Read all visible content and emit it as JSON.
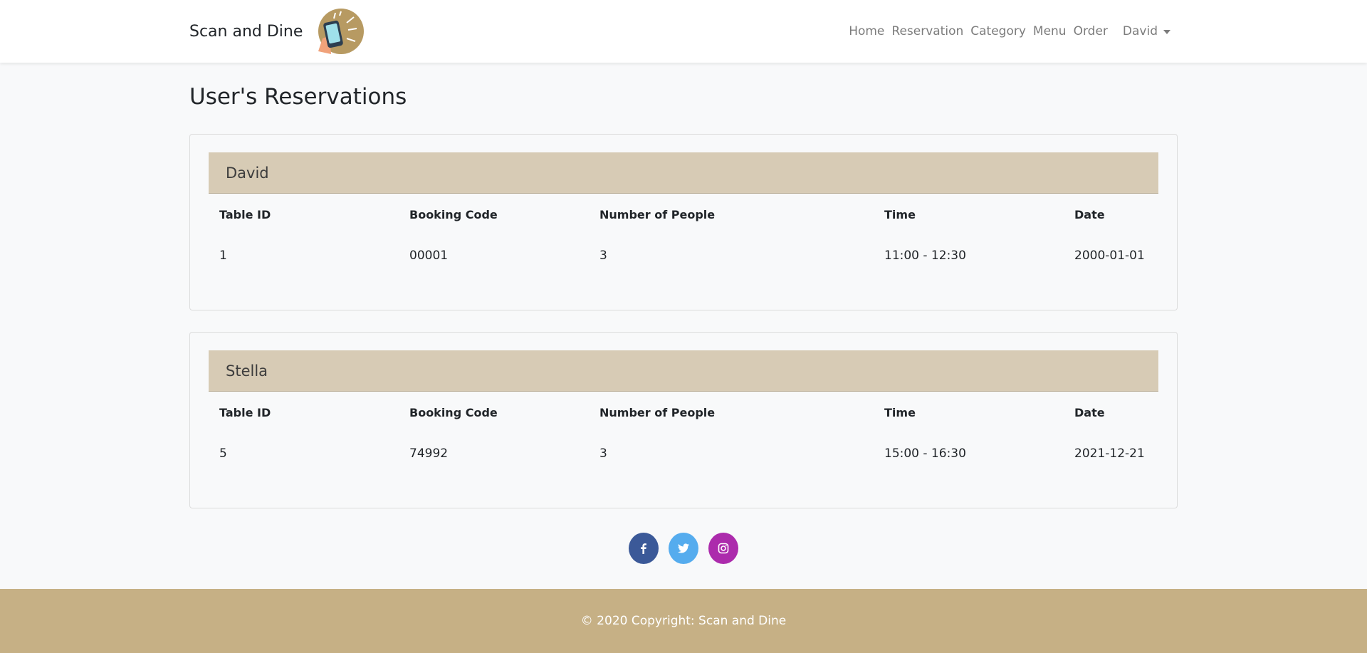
{
  "brand": {
    "name": "Scan and Dine",
    "logo_icon": "phone-hand-icon"
  },
  "nav": {
    "links": [
      "Home",
      "Reservation",
      "Category",
      "Menu",
      "Order"
    ],
    "user": "David"
  },
  "page": {
    "title": "User's Reservations"
  },
  "table_headers": [
    "Table ID",
    "Booking Code",
    "Number of People",
    "Time",
    "Date"
  ],
  "reservations": [
    {
      "name": "David",
      "rows": [
        {
          "table_id": "1",
          "booking_code": "00001",
          "people": "3",
          "time": "11:00 - 12:30",
          "date": "2000-01-01"
        }
      ]
    },
    {
      "name": "Stella",
      "rows": [
        {
          "table_id": "5",
          "booking_code": "74992",
          "people": "3",
          "time": "15:00 - 16:30",
          "date": "2021-12-21"
        }
      ]
    }
  ],
  "socials": [
    {
      "icon": "facebook-icon",
      "color": "#3b5998"
    },
    {
      "icon": "twitter-icon",
      "color": "#55acee"
    },
    {
      "icon": "instagram-icon",
      "color": "#ac2bac"
    }
  ],
  "footer": {
    "text": "© 2020 Copyright: Scan and Dine"
  },
  "colors": {
    "card_header": "#d7cbb5",
    "footer": "#c6b085",
    "nav_text": "#7c7c7c"
  }
}
